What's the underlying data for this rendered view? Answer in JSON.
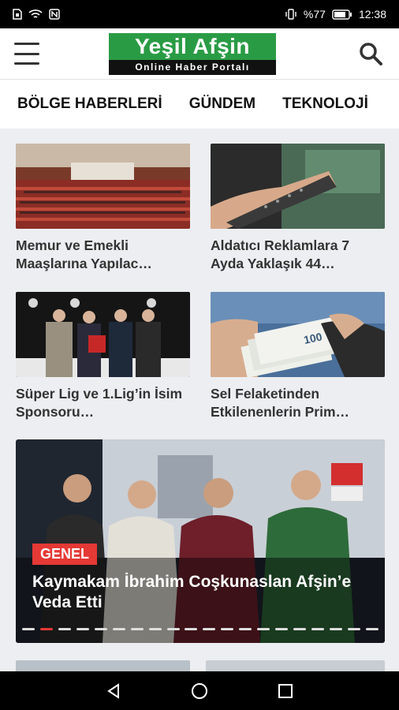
{
  "status_bar": {
    "battery_text": "%77",
    "time": "12:38"
  },
  "header": {
    "logo_title": "Yeşil Afşin",
    "logo_tagline": "Online Haber Portalı"
  },
  "tabs": [
    {
      "label": "BÖLGE HABERLERİ"
    },
    {
      "label": "GÜNDEM"
    },
    {
      "label": "TEKNOLOJİ"
    }
  ],
  "news_cards": [
    {
      "title": "Memur ve Emekli Maaşlarına Yapılac…"
    },
    {
      "title": "Aldatıcı Reklamlara 7 Ayda Yaklaşık 44…"
    },
    {
      "title": "Süper Lig ve 1.Lig’in İsim Sponsoru…"
    },
    {
      "title": "Sel Felaketinden Etkilenenlerin Prim…"
    }
  ],
  "featured": {
    "category": "GENEL",
    "headline": "Kaymakam İbrahim Coşkunaslan Afşin’e Veda Etti",
    "slide_count": 20,
    "active_slide": 2
  },
  "colors": {
    "brand_green": "#2a9b45",
    "accent_red": "#e53935"
  }
}
